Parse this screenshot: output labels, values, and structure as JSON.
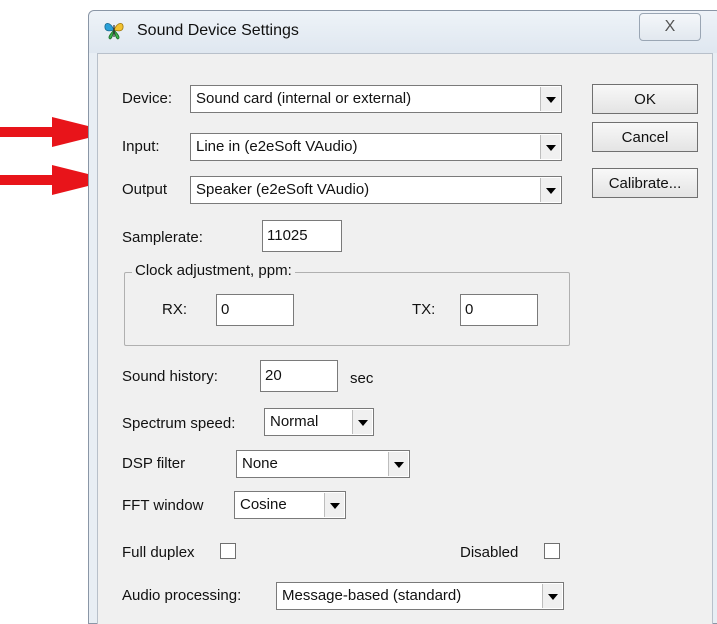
{
  "window": {
    "title": "Sound Device Settings",
    "icons": {
      "app": "butterfly-icon",
      "close": "close-icon"
    },
    "close_glyph": "X"
  },
  "device": {
    "label": "Device:",
    "value": "Sound card (internal or external)"
  },
  "input": {
    "label": "Input:",
    "value": "Line in (e2eSoft VAudio)"
  },
  "output": {
    "label": "Output",
    "value": "Speaker (e2eSoft VAudio)"
  },
  "buttons": {
    "ok": "OK",
    "cancel": "Cancel",
    "calibrate": "Calibrate..."
  },
  "samplerate": {
    "label": "Samplerate:",
    "value": "11025"
  },
  "clock": {
    "title": "Clock adjustment, ppm:",
    "rx_label": "RX:",
    "rx_value": "0",
    "tx_label": "TX:",
    "tx_value": "0"
  },
  "sound_history": {
    "label": "Sound history:",
    "value": "20",
    "unit": "sec"
  },
  "spectrum_speed": {
    "label": "Spectrum speed:",
    "value": "Normal"
  },
  "dsp_filter": {
    "label": "DSP filter",
    "value": "None"
  },
  "fft_window": {
    "label": "FFT window",
    "value": "Cosine"
  },
  "full_duplex": {
    "label": "Full duplex",
    "checked": false
  },
  "disabled": {
    "label": "Disabled",
    "checked": false
  },
  "audio_processing": {
    "label": "Audio processing:",
    "value": "Message-based (standard)"
  },
  "colors": {
    "annotation_arrow": "#e8141a"
  }
}
